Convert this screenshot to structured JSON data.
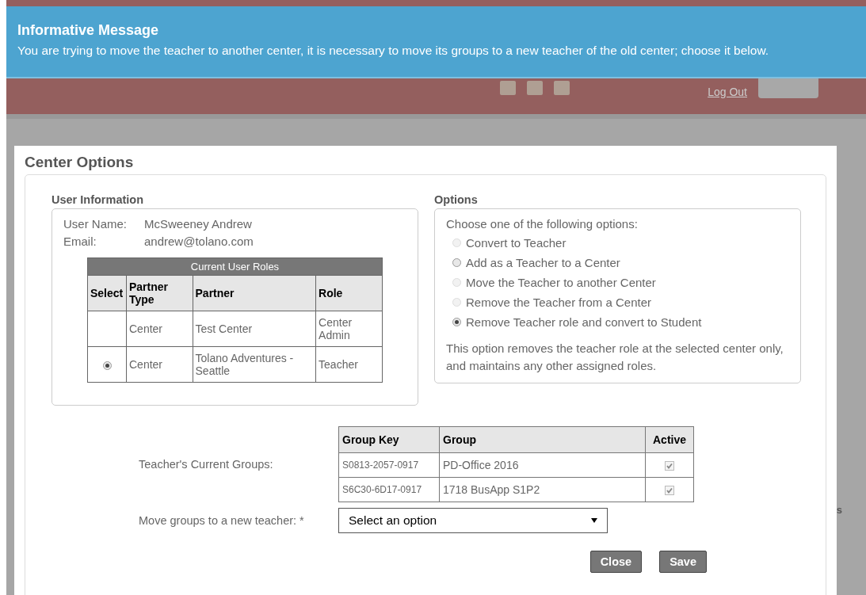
{
  "banner": {
    "title": "Informative Message",
    "message": "You are trying to move the teacher to another center, it is necessary to move its groups to a new teacher of the old center; choose it below."
  },
  "header": {
    "logout": "Log Out"
  },
  "background_fragments": {
    "right": "s"
  },
  "modal": {
    "title": "Center Options",
    "user_info": {
      "heading": "User Information",
      "fields": [
        {
          "label": "User Name:",
          "value": "McSweeney Andrew"
        },
        {
          "label": "Email:",
          "value": "andrew@tolano.com"
        }
      ],
      "roles_table": {
        "caption": "Current User Roles",
        "columns": [
          "Select",
          "Partner Type",
          "Partner",
          "Role"
        ],
        "rows": [
          {
            "kind": "none",
            "partner_type": "Center",
            "partner": "Test Center",
            "role": "Center Admin"
          },
          {
            "kind": "radio",
            "selected": true,
            "partner_type": "Center",
            "partner": "Tolano Adventures - Seattle",
            "role": "Teacher"
          }
        ]
      }
    },
    "options": {
      "heading": "Options",
      "prompt": "Choose one of the following options:",
      "items": [
        {
          "label": "Convert to Teacher",
          "selected": false,
          "disabled": true
        },
        {
          "label": "Add as a Teacher to a Center",
          "selected": false,
          "disabled": false
        },
        {
          "label": "Move the Teacher to another Center",
          "selected": false,
          "disabled": true
        },
        {
          "label": "Remove the Teacher from a Center",
          "selected": false,
          "disabled": true
        },
        {
          "label": "Remove Teacher role and convert to Student",
          "selected": true,
          "disabled": false
        }
      ],
      "note": "This option removes the teacher role at the selected center only, and maintains any other assigned roles."
    },
    "groups": {
      "label": "Teacher's Current Groups:",
      "columns": [
        "Group Key",
        "Group",
        "Active"
      ],
      "rows": [
        {
          "key": "S0813-2057-0917",
          "group": "PD-Office 2016",
          "active": true
        },
        {
          "key": "S6C30-6D17-0917",
          "group": "1718 BusApp S1P2",
          "active": true
        }
      ]
    },
    "new_teacher": {
      "label": "Move groups to a new teacher: *",
      "placeholder": "Select an option"
    },
    "buttons": [
      "Close",
      "Save"
    ]
  }
}
